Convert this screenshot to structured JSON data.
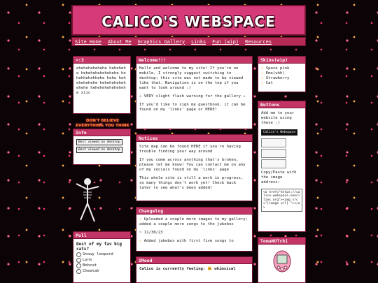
{
  "site_title": "CALICO'S WEBSPACE",
  "nav": [
    "Site Home",
    "About Me",
    "Graphics Gallery",
    "Links",
    "Fun (wip)",
    "Resources"
  ],
  "left": {
    "box1_title": ">:3",
    "box1_text": "ehehehehehehe hehehehe hehehehehehehehe hehehhehehhehe hehe hehehehehehe hehehehehehehehe hehehehehehehehe xiic",
    "disclaimer": "DON'T BELIEVE EVERYTHING YOU THINK",
    "info_title": "Info",
    "badge1": "Best viewed on desktop",
    "badge2": "Best viewed on desktop",
    "poll_title": "Poll",
    "poll_question": "Best of my fav big cats?",
    "poll_options": [
      "Snowy leopard",
      "Lynx",
      "Bobcat",
      "Cheetah"
    ]
  },
  "center": {
    "welcome_title": "Welcome!!!",
    "welcome_p1": "Hello and welcome to my site! If you're on mobile, I strongly suggest switching to desktop; this site was not made to be viewed like that. Navigation is on the top if you want to look around :)",
    "welcome_p2": "⚠ VERY slight flash warning for the gallery ⚠",
    "welcome_p3": "If you'd like to sign my guestbook, it can be found on my 'links' page or HERE!",
    "notices_title": "Notices",
    "notices_p1": "Site map can be found HERE if you're having trouble finding your way around",
    "notices_p2": "If you come across anything that's broken, please let me know! You can contact me on any of my socials found on my 'links' page",
    "notices_p3": "This whole site is still a work in progress, so many things don't work yet! Check back later to see what's been added!",
    "changelog_title": "Changelog",
    "changelog_items": [
      "Uploaded a couple more images to my gallery; added a couple more songs to the jukebox",
      "~ 11/30/23",
      "Added jukebox with first five songs to"
    ],
    "mood_title": "IMood",
    "mood_text": "Calico is currently feeling:",
    "mood_value": "whimsical"
  },
  "right": {
    "skins_title": "Skins(wip)",
    "skins": [
      "Space pink",
      "Emo(uhh)",
      "Strawberry",
      "Cat"
    ],
    "buttons_title": "Buttons",
    "buttons_text": "Add me to your website using these :)",
    "button_label": "Calico's Webspace",
    "copy_text": "Copy/Paste with the image address:",
    "code": "<a href=\"https://calico-webspace.neocities.org\"><img src=\"[image url] \"></a>",
    "tama_title": "TomaNOTchi"
  }
}
